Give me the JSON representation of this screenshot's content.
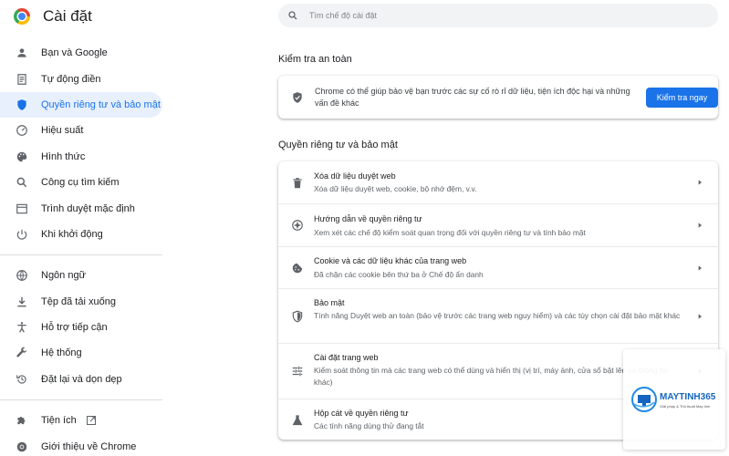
{
  "app": {
    "title": "Cài đặt"
  },
  "sidebar": {
    "items": [
      {
        "label": "Bạn và Google",
        "icon": "person-icon"
      },
      {
        "label": "Tự động điền",
        "icon": "document-icon"
      },
      {
        "label": "Quyền riêng tư và bảo mật",
        "icon": "shield-icon",
        "active": true
      },
      {
        "label": "Hiệu suất",
        "icon": "speedometer-icon"
      },
      {
        "label": "Hình thức",
        "icon": "palette-icon"
      },
      {
        "label": "Công cụ tìm kiếm",
        "icon": "search-icon"
      },
      {
        "label": "Trình duyệt mặc định",
        "icon": "browser-icon"
      },
      {
        "label": "Khi khởi động",
        "icon": "power-icon"
      }
    ],
    "items2": [
      {
        "label": "Ngôn ngữ",
        "icon": "globe-icon"
      },
      {
        "label": "Tệp đã tải xuống",
        "icon": "download-icon"
      },
      {
        "label": "Hỗ trợ tiếp cận",
        "icon": "accessibility-icon"
      },
      {
        "label": "Hệ thống",
        "icon": "wrench-icon"
      },
      {
        "label": "Đặt lại và dọn dẹp",
        "icon": "restore-icon"
      }
    ],
    "items3": [
      {
        "label": "Tiện ích",
        "icon": "puzzle-icon"
      },
      {
        "label": "Giới thiệu về Chrome",
        "icon": "chrome-icon"
      }
    ]
  },
  "search": {
    "placeholder": "Tìm chế độ cài đặt"
  },
  "safety": {
    "title": "Kiểm tra an toàn",
    "text": "Chrome có thể giúp bảo vệ bạn trước các sự cố rò rỉ dữ liệu, tiện ích độc hại và những vấn đề khác",
    "button": "Kiểm tra ngay"
  },
  "privacy": {
    "title": "Quyền riêng tư và bảo mật",
    "rows": [
      {
        "title": "Xóa dữ liệu duyệt web",
        "subtitle": "Xóa dữ liệu duyệt web, cookie, bộ nhớ đệm, v.v.",
        "icon": "trash-icon"
      },
      {
        "title": "Hướng dẫn về quyền riêng tư",
        "subtitle": "Xem xét các chế độ kiểm soát quan trọng đối với quyền riêng tư và tính bảo mật",
        "icon": "compass-icon"
      },
      {
        "title": "Cookie và các dữ liệu khác của trang web",
        "subtitle": "Đã chặn các cookie bên thứ ba ở Chế độ ẩn danh",
        "icon": "cookie-icon"
      },
      {
        "title": "Bảo mật",
        "subtitle": "Tính năng Duyệt web an toàn (bảo vệ trước các trang web nguy hiểm) và các tùy chọn cài đặt bảo mật khác",
        "icon": "shield-icon"
      },
      {
        "title": "Cài đặt trang web",
        "subtitle": "Kiểm soát thông tin mà các trang web có thể dùng và hiển thị (vị trí, máy ảnh, cửa sổ bật lên và thông tin khác)",
        "icon": "sliders-icon"
      },
      {
        "title": "Hộp cát về quyền riêng tư",
        "subtitle": "Các tính năng dùng thử đang tắt",
        "icon": "flask-icon"
      }
    ]
  },
  "watermark": {
    "brand": "MAYTINH365",
    "tagline": "Giải pháp & Thủ thuật Máy tính"
  },
  "colors": {
    "accent": "#1a73e8",
    "active_bg": "#e8f0fe",
    "text": "#202124",
    "subtext": "#5f6368"
  }
}
